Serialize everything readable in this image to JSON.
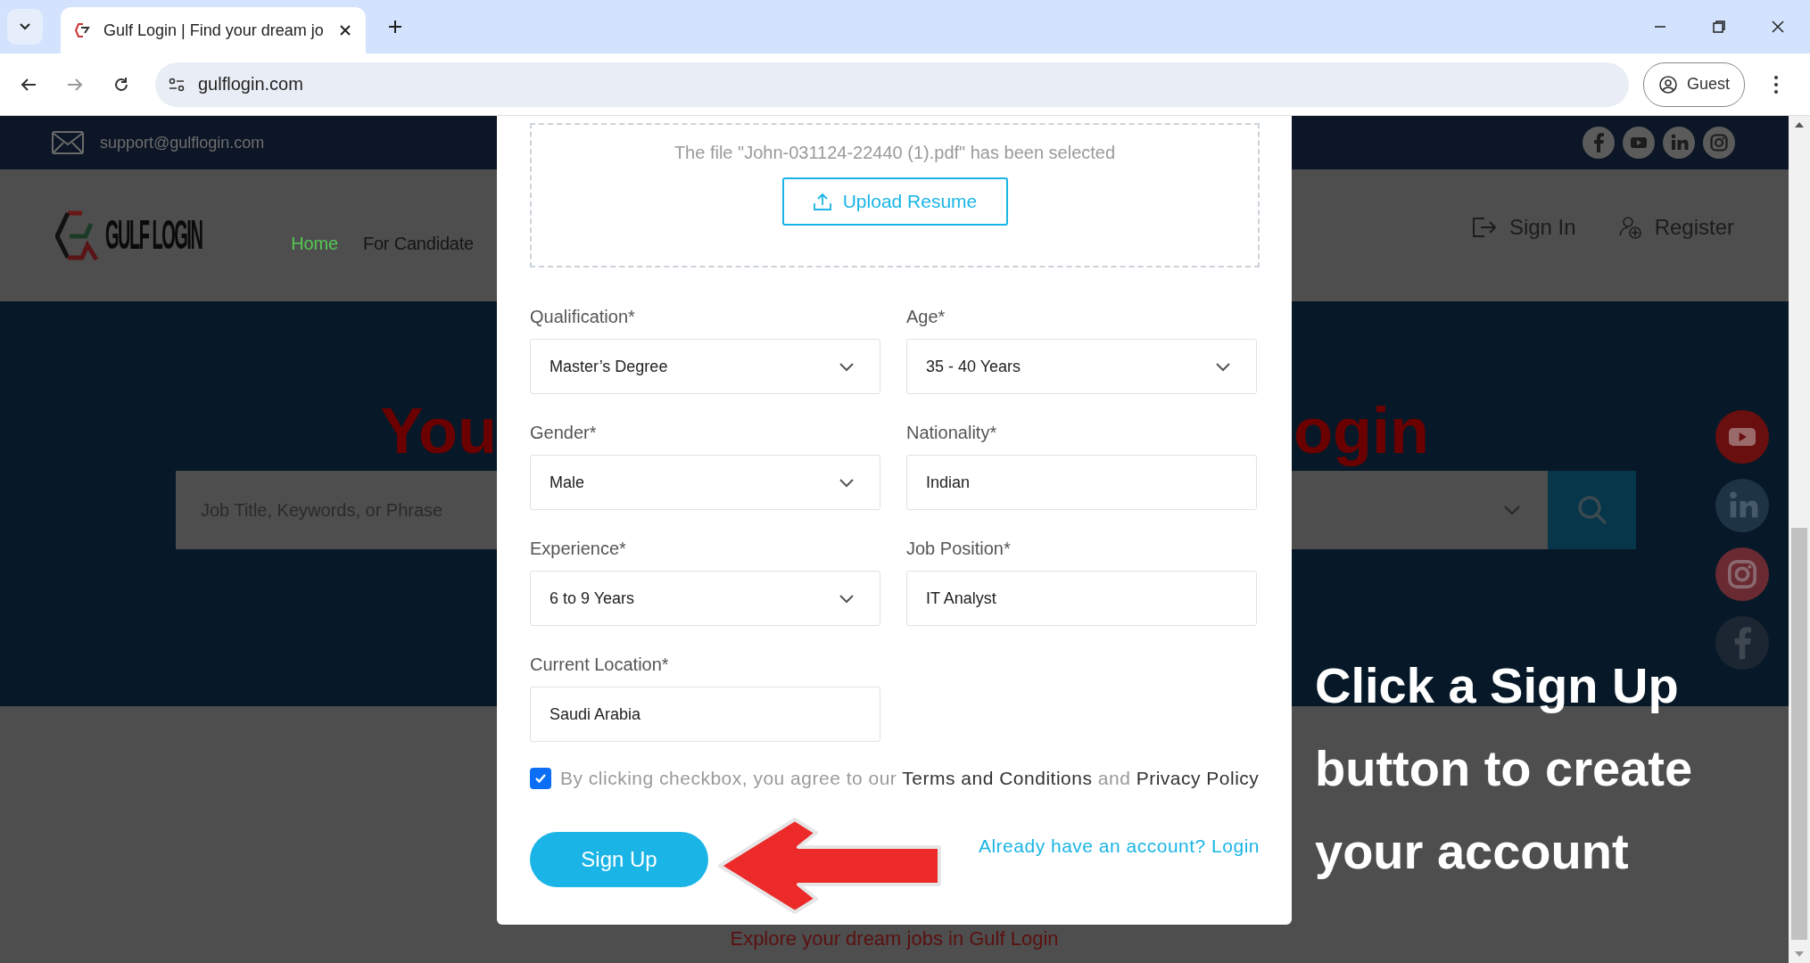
{
  "browser": {
    "tab_title": "Gulf Login | Find your dream jo",
    "url": "gulflogin.com",
    "profile": "Guest"
  },
  "top_bar": {
    "email": "support@gulflogin.com"
  },
  "header": {
    "logo_text": "GULF LOGIN",
    "nav": [
      {
        "label": "Home",
        "selected": true
      },
      {
        "label": "For Candidate",
        "selected": false
      }
    ],
    "sign_in": "Sign In",
    "register": "Register"
  },
  "hero": {
    "title_left": "You",
    "title_right": "ogin",
    "search_placeholder": "Job Title, Keywords, or Phrase",
    "tagline": "Explore your dream jobs in Gulf Login"
  },
  "modal": {
    "file_status": "The file \"John-031124-22440 (1).pdf\" has been selected",
    "upload_button": "Upload Resume",
    "fields": [
      {
        "label": "Qualification*",
        "kind": "select",
        "value": "Master’s Degree"
      },
      {
        "label": "Age*",
        "kind": "select",
        "value": "35 - 40 Years"
      },
      {
        "label": "Gender*",
        "kind": "select",
        "value": "Male"
      },
      {
        "label": "Nationality*",
        "kind": "text",
        "value": "Indian"
      },
      {
        "label": "Experience*",
        "kind": "select",
        "value": "6 to 9 Years"
      },
      {
        "label": "Job Position*",
        "kind": "text",
        "value": "IT Analyst"
      },
      {
        "label": "Current Location*",
        "kind": "text",
        "value": "Saudi Arabia"
      }
    ],
    "agreement": {
      "checked": true,
      "prefix": "By clicking checkbox, you agree to our",
      "terms": "Terms and Conditions",
      "middle": "and",
      "privacy": "Privacy Policy"
    },
    "sign_up_button": "Sign Up",
    "login_link": "Already have an account? Login"
  },
  "annotation": {
    "text": "Click a Sign Up button to create your account"
  }
}
